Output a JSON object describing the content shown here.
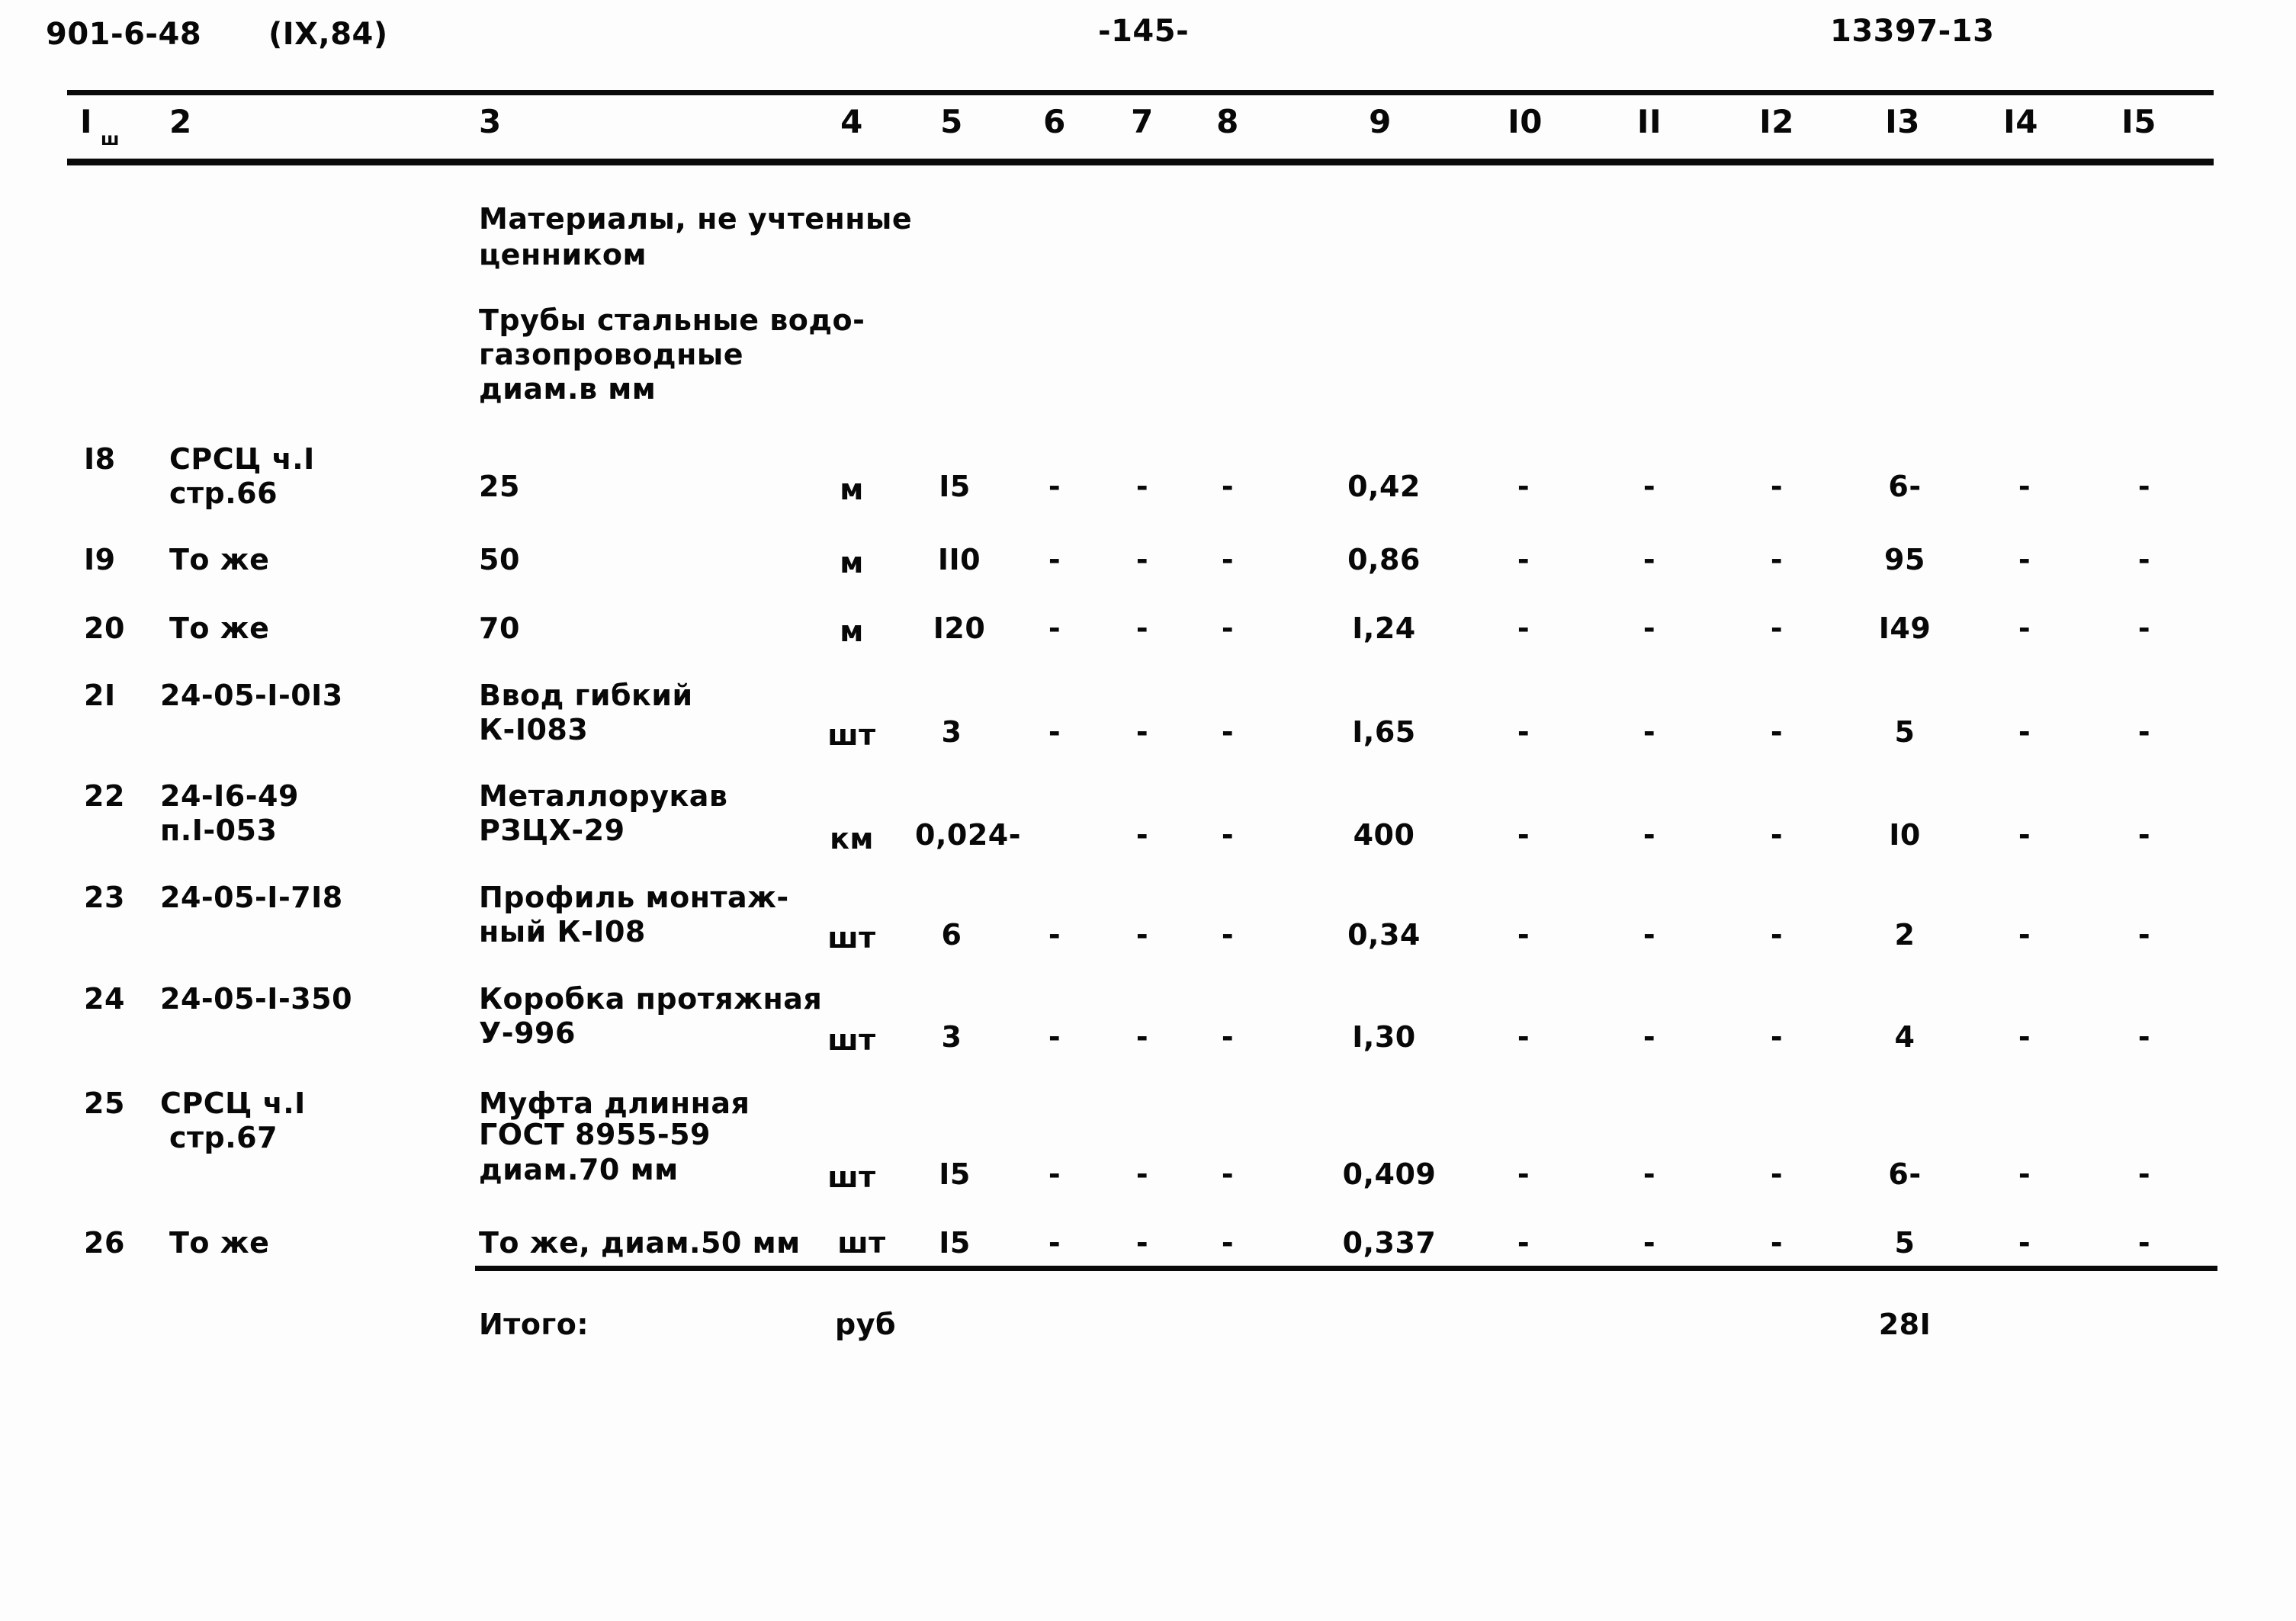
{
  "header": {
    "doc_code": "901-6-48",
    "revision": "(IX,84)",
    "page_number": "-145-",
    "sheet_code": "13397-13"
  },
  "columns": {
    "labels": [
      "I",
      "2",
      "3",
      "4",
      "5",
      "6",
      "7",
      "8",
      "9",
      "I0",
      "II",
      "I2",
      "I3",
      "I4",
      "I5"
    ],
    "col1_subscript": "ш"
  },
  "section_titles": {
    "materials": [
      "Материалы, не учтенные",
      "ценником"
    ],
    "pipes": [
      "Трубы стальные водо-",
      "газопроводные",
      "диам.в мм"
    ]
  },
  "rows": [
    {
      "num": "I8",
      "ref": [
        "СРСЦ ч.I",
        "стр.66"
      ],
      "name": [
        "25"
      ],
      "unit": "м",
      "qty": "I5",
      "c6": "-",
      "c7": "-",
      "c8": "-",
      "c9": "0,42",
      "c10": "-",
      "c11": "-",
      "c12": "-",
      "c13": "6-",
      "c14": "-",
      "c15": "-"
    },
    {
      "num": "I9",
      "ref": [
        "То же"
      ],
      "name": [
        "50"
      ],
      "unit": "м",
      "qty": "II0",
      "c6": "-",
      "c7": "-",
      "c8": "-",
      "c9": "0,86",
      "c10": "-",
      "c11": "-",
      "c12": "-",
      "c13": "95",
      "c14": "-",
      "c15": "-"
    },
    {
      "num": "20",
      "ref": [
        "То же"
      ],
      "name": [
        "70"
      ],
      "unit": "м",
      "qty": "I20",
      "c6": "-",
      "c7": "-",
      "c8": "-",
      "c9": "I,24",
      "c10": "-",
      "c11": "-",
      "c12": "-",
      "c13": "I49",
      "c14": "-",
      "c15": "-"
    },
    {
      "num": "2I",
      "ref": [
        "24-05-I-0I3"
      ],
      "name": [
        "Ввод гибкий",
        "К-I083"
      ],
      "unit": "шт",
      "qty": "3",
      "c6": "-",
      "c7": "-",
      "c8": "-",
      "c9": "I,65",
      "c10": "-",
      "c11": "-",
      "c12": "-",
      "c13": "5",
      "c14": "-",
      "c15": "-"
    },
    {
      "num": "22",
      "ref": [
        "24-I6-49",
        "п.I-053"
      ],
      "name": [
        "Металлорукав",
        "РЗЦХ-29"
      ],
      "unit": "км",
      "qty": "0,024-",
      "c6": "",
      "c7": "-",
      "c8": "-",
      "c9": "400",
      "c10": "-",
      "c11": "-",
      "c12": "-",
      "c13": "I0",
      "c14": "-",
      "c15": "-"
    },
    {
      "num": "23",
      "ref": [
        "24-05-I-7I8"
      ],
      "name": [
        "Профиль монтаж-",
        "ный К-I08"
      ],
      "unit": "шт",
      "qty": "6",
      "c6": "-",
      "c7": "-",
      "c8": "-",
      "c9": "0,34",
      "c10": "-",
      "c11": "-",
      "c12": "-",
      "c13": "2",
      "c14": "-",
      "c15": "-"
    },
    {
      "num": "24",
      "ref": [
        "24-05-I-350"
      ],
      "name": [
        "Коробка протяжная",
        "У-996"
      ],
      "unit": "шт",
      "qty": "3",
      "c6": "-",
      "c7": "-",
      "c8": "-",
      "c9": "I,30",
      "c10": "-",
      "c11": "-",
      "c12": "-",
      "c13": "4",
      "c14": "-",
      "c15": "-"
    },
    {
      "num": "25",
      "ref": [
        "СРСЦ ч.I",
        "стр.67"
      ],
      "name": [
        "Муфта длинная",
        "ГОСТ 8955-59",
        "диам.70 мм"
      ],
      "unit": "шт",
      "qty": "I5",
      "c6": "-",
      "c7": "-",
      "c8": "-",
      "c9": "0,409",
      "c10": "-",
      "c11": "-",
      "c12": "-",
      "c13": "6-",
      "c14": "-",
      "c15": "-"
    },
    {
      "num": "26",
      "ref": [
        "То же"
      ],
      "name": [
        "То же, диам.50 мм"
      ],
      "unit": "шт",
      "qty": "I5",
      "c6": "-",
      "c7": "-",
      "c8": "-",
      "c9": "0,337",
      "c10": "-",
      "c11": "-",
      "c12": "-",
      "c13": "5",
      "c14": "-",
      "c15": "-"
    }
  ],
  "total": {
    "label": "Итого:",
    "unit": "руб",
    "value": "28I"
  }
}
